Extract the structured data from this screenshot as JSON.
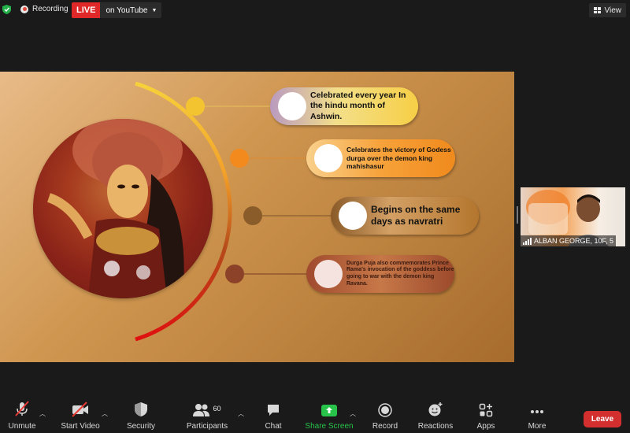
{
  "topbar": {
    "recording_label": "Recording",
    "live_label": "LIVE",
    "stream_label": "on YouTube",
    "view_label": "View"
  },
  "slide": {
    "points": [
      "Celebrated every year In the hindu month of Ashwin.",
      "Celebrates the victory of Godess durga over the demon king mahishasur",
      "Begins on the same days as navratri",
      "Durga Puja also commemorates Prince Rama's invocation of the goddess before going to war with the demon king Ravana."
    ]
  },
  "participant": {
    "name": "ALBAN GEORGE, 10F, 5"
  },
  "toolbar": {
    "unmute": "Unmute",
    "start_video": "Start Video",
    "security": "Security",
    "participants": "Participants",
    "participants_count": "60",
    "chat": "Chat",
    "share_screen": "Share Screen",
    "record": "Record",
    "reactions": "Reactions",
    "apps": "Apps",
    "more": "More",
    "leave": "Leave"
  },
  "colors": {
    "live": "#e02828",
    "share_green": "#28c34a",
    "leave": "#d32f2f",
    "slide_bg": "#cf9650"
  }
}
